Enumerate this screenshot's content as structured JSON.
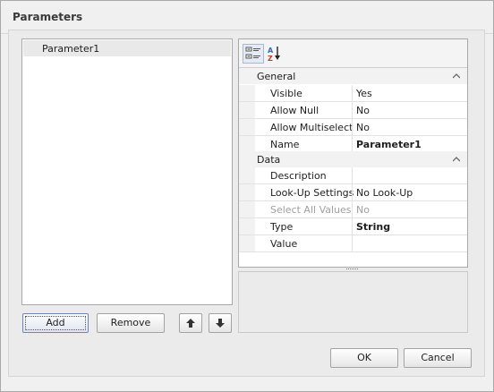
{
  "window": {
    "title": "Parameters"
  },
  "parameters": [
    "Parameter1"
  ],
  "list_buttons": {
    "add": "Add",
    "remove": "Remove"
  },
  "property_grid": {
    "toolbar": {
      "categorized_icon": "categorized-view-icon",
      "alphabetical_icon": "sort-az-icon"
    },
    "categories": [
      {
        "name": "General",
        "properties": [
          {
            "name": "Visible",
            "value": "Yes"
          },
          {
            "name": "Allow Null",
            "value": "No"
          },
          {
            "name": "Allow Multiselect",
            "value": "No"
          },
          {
            "name": "Name",
            "value": "Parameter1"
          }
        ]
      },
      {
        "name": "Data",
        "properties": [
          {
            "name": "Description",
            "value": ""
          },
          {
            "name": "Look-Up Settings",
            "value": "No Look-Up"
          },
          {
            "name": "Select All Values",
            "value": "No"
          },
          {
            "name": "Type",
            "value": "String"
          },
          {
            "name": "Value",
            "value": ""
          }
        ]
      }
    ]
  },
  "dialog_buttons": {
    "ok": "OK",
    "cancel": "Cancel"
  }
}
